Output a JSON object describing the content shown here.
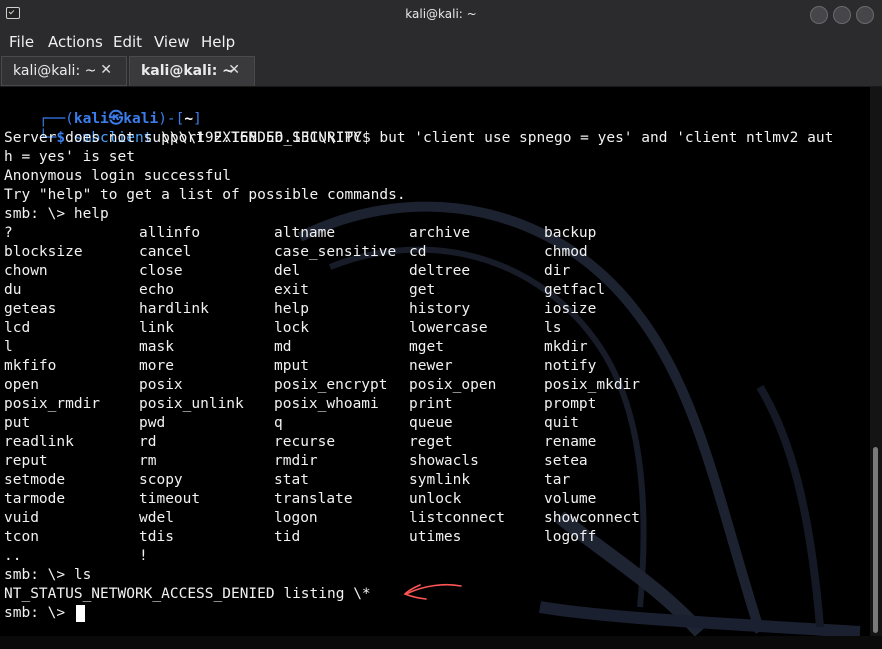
{
  "window": {
    "title": "kali@kali: ~"
  },
  "menu": [
    "File",
    "Actions",
    "Edit",
    "View",
    "Help"
  ],
  "tabs": [
    {
      "label": "kali@kali: ~",
      "close": "✕",
      "active": false
    },
    {
      "label": "kali@kali: ~",
      "close": "✕",
      "active": true
    }
  ],
  "prompt": {
    "frame_top": "┌──(",
    "user": "kali",
    "at": "㉿",
    "host": "kali",
    "frame_mid": ")-[",
    "path": "~",
    "frame_end": "]",
    "frame_bottom": "└─",
    "dollar": "$",
    "command": "smbclient",
    "args": " \\\\\\\\192.168.56.131\\\\IPC$"
  },
  "output": [
    "Server does not support EXTENDED_SECURITY  but 'client use spnego = yes' and 'client ntlmv2 aut",
    "h = yes' is set",
    "Anonymous login successful",
    "Try \"help\" to get a list of possible commands.",
    "smb: \\> help"
  ],
  "help_commands": [
    [
      "?",
      "allinfo",
      "altname",
      "archive",
      "backup"
    ],
    [
      "blocksize",
      "cancel",
      "case_sensitive",
      "cd",
      "chmod"
    ],
    [
      "chown",
      "close",
      "del",
      "deltree",
      "dir"
    ],
    [
      "du",
      "echo",
      "exit",
      "get",
      "getfacl"
    ],
    [
      "geteas",
      "hardlink",
      "help",
      "history",
      "iosize"
    ],
    [
      "lcd",
      "link",
      "lock",
      "lowercase",
      "ls"
    ],
    [
      "l",
      "mask",
      "md",
      "mget",
      "mkdir"
    ],
    [
      "mkfifo",
      "more",
      "mput",
      "newer",
      "notify"
    ],
    [
      "open",
      "posix",
      "posix_encrypt",
      "posix_open",
      "posix_mkdir"
    ],
    [
      "posix_rmdir",
      "posix_unlink",
      "posix_whoami",
      "print",
      "prompt"
    ],
    [
      "put",
      "pwd",
      "q",
      "queue",
      "quit"
    ],
    [
      "readlink",
      "rd",
      "recurse",
      "reget",
      "rename"
    ],
    [
      "reput",
      "rm",
      "rmdir",
      "showacls",
      "setea"
    ],
    [
      "setmode",
      "scopy",
      "stat",
      "symlink",
      "tar"
    ],
    [
      "tarmode",
      "timeout",
      "translate",
      "unlock",
      "volume"
    ],
    [
      "vuid",
      "wdel",
      "logon",
      "listconnect",
      "showconnect"
    ],
    [
      "tcon",
      "tdis",
      "tid",
      "utimes",
      "logoff"
    ],
    [
      "..",
      "!",
      "",
      "",
      ""
    ]
  ],
  "after": [
    "smb: \\> ls",
    "NT_STATUS_NETWORK_ACCESS_DENIED listing \\*",
    "smb: \\> "
  ],
  "colors": {
    "accent_blue": "#3b7ded",
    "annotation_red": "#ff5555",
    "terminal_bg": "#000000",
    "chrome_bg": "#2b2b2d"
  }
}
